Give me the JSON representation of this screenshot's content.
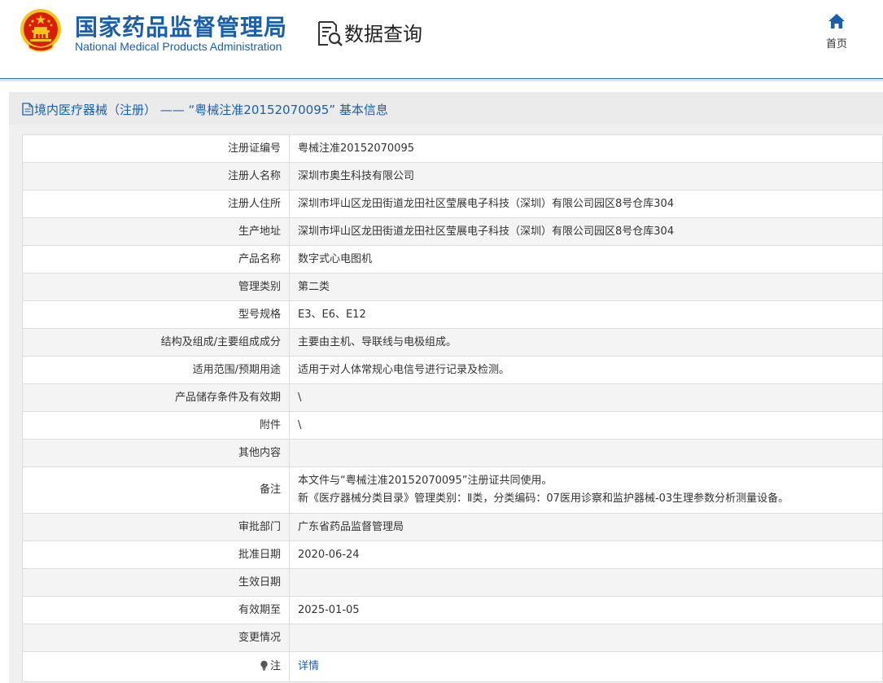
{
  "header": {
    "org_name_cn": "国家药品监督管理局",
    "org_name_en": "National Medical Products Administration",
    "query_title": "数据查询",
    "home_label": "首页"
  },
  "colors": {
    "brand_blue": "#1a5fad",
    "emblem_red": "#d81e06",
    "emblem_gold": "#f5c518"
  },
  "icons": {
    "emblem": "national-emblem-icon",
    "query": "document-search-icon",
    "home": "home-icon",
    "title": "document-icon",
    "notes": "lightbulb-icon"
  },
  "page_title": "境内医疗器械（注册） ——  “粤械注准20152070095”  基本信息",
  "rows": [
    {
      "label": "注册证编号",
      "value": "粤械注准20152070095"
    },
    {
      "label": "注册人名称",
      "value": "深圳市奥生科技有限公司"
    },
    {
      "label": "注册人住所",
      "value": "深圳市坪山区龙田街道龙田社区莹展电子科技（深圳）有限公司园区8号仓库304"
    },
    {
      "label": "生产地址",
      "value": "深圳市坪山区龙田街道龙田社区莹展电子科技（深圳）有限公司园区8号仓库304"
    },
    {
      "label": "产品名称",
      "value": "数字式心电图机"
    },
    {
      "label": "管理类别",
      "value": "第二类"
    },
    {
      "label": "型号规格",
      "value": "E3、E6、E12"
    },
    {
      "label": "结构及组成/主要组成成分",
      "value": "主要由主机、导联线与电极组成。"
    },
    {
      "label": "适用范围/预期用途",
      "value": "适用于对人体常规心电信号进行记录及检测。"
    },
    {
      "label": "产品储存条件及有效期",
      "value": "\\"
    },
    {
      "label": "附件",
      "value": "\\"
    },
    {
      "label": "其他内容",
      "value": ""
    },
    {
      "label": "备注",
      "value_line1": "本文件与“粤械注准20152070095”注册证共同使用。",
      "value_line2": "新《医疗器械分类目录》管理类别：Ⅱ类，分类编码：07医用诊察和监护器械-03生理参数分析测量设备。"
    },
    {
      "label": "审批部门",
      "value": "广东省药品监督管理局"
    },
    {
      "label": "批准日期",
      "value": "2020-06-24"
    },
    {
      "label": "生效日期",
      "value": ""
    },
    {
      "label": "有效期至",
      "value": "2025-01-05"
    },
    {
      "label": "变更情况",
      "value": ""
    }
  ],
  "notes": {
    "label": "注",
    "link_text": "详情"
  }
}
